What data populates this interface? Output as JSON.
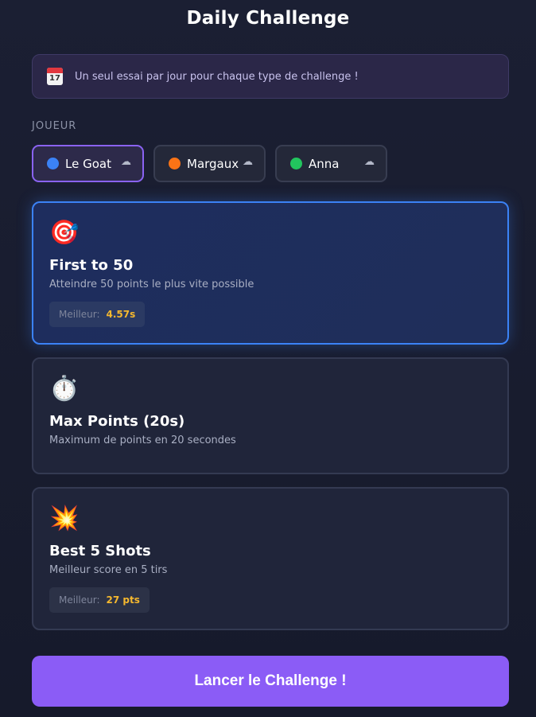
{
  "header": {
    "title": "Daily Challenge"
  },
  "banner": {
    "icon": "calendar-icon",
    "day": "17",
    "text": "Un seul essai par jour pour chaque type de challenge !"
  },
  "players": {
    "label": "JOUEUR",
    "items": [
      {
        "name": "Le Goat",
        "color": "#3b82f6",
        "cloud": "☁",
        "selected": true
      },
      {
        "name": "Margaux",
        "color": "#f97316",
        "cloud": "☁",
        "selected": false
      },
      {
        "name": "Anna",
        "color": "#22c55e",
        "cloud": "☁",
        "selected": false
      }
    ]
  },
  "challenges": [
    {
      "icon": "target-icon",
      "emoji": "🎯",
      "title": "First to 50",
      "description": "Atteindre 50 points le plus vite possible",
      "best_label": "Meilleur:",
      "best_value": "4.57s",
      "active": true
    },
    {
      "icon": "stopwatch-icon",
      "emoji": "⏱️",
      "title": "Max Points (20s)",
      "description": "Maximum de points en 20 secondes",
      "active": false
    },
    {
      "icon": "explosion-icon",
      "emoji": "💥",
      "title": "Best 5 Shots",
      "description": "Meilleur score en 5 tirs",
      "best_label": "Meilleur:",
      "best_value": "27 pts",
      "active": false
    }
  ],
  "launch_button": {
    "label": "Lancer le Challenge !"
  }
}
